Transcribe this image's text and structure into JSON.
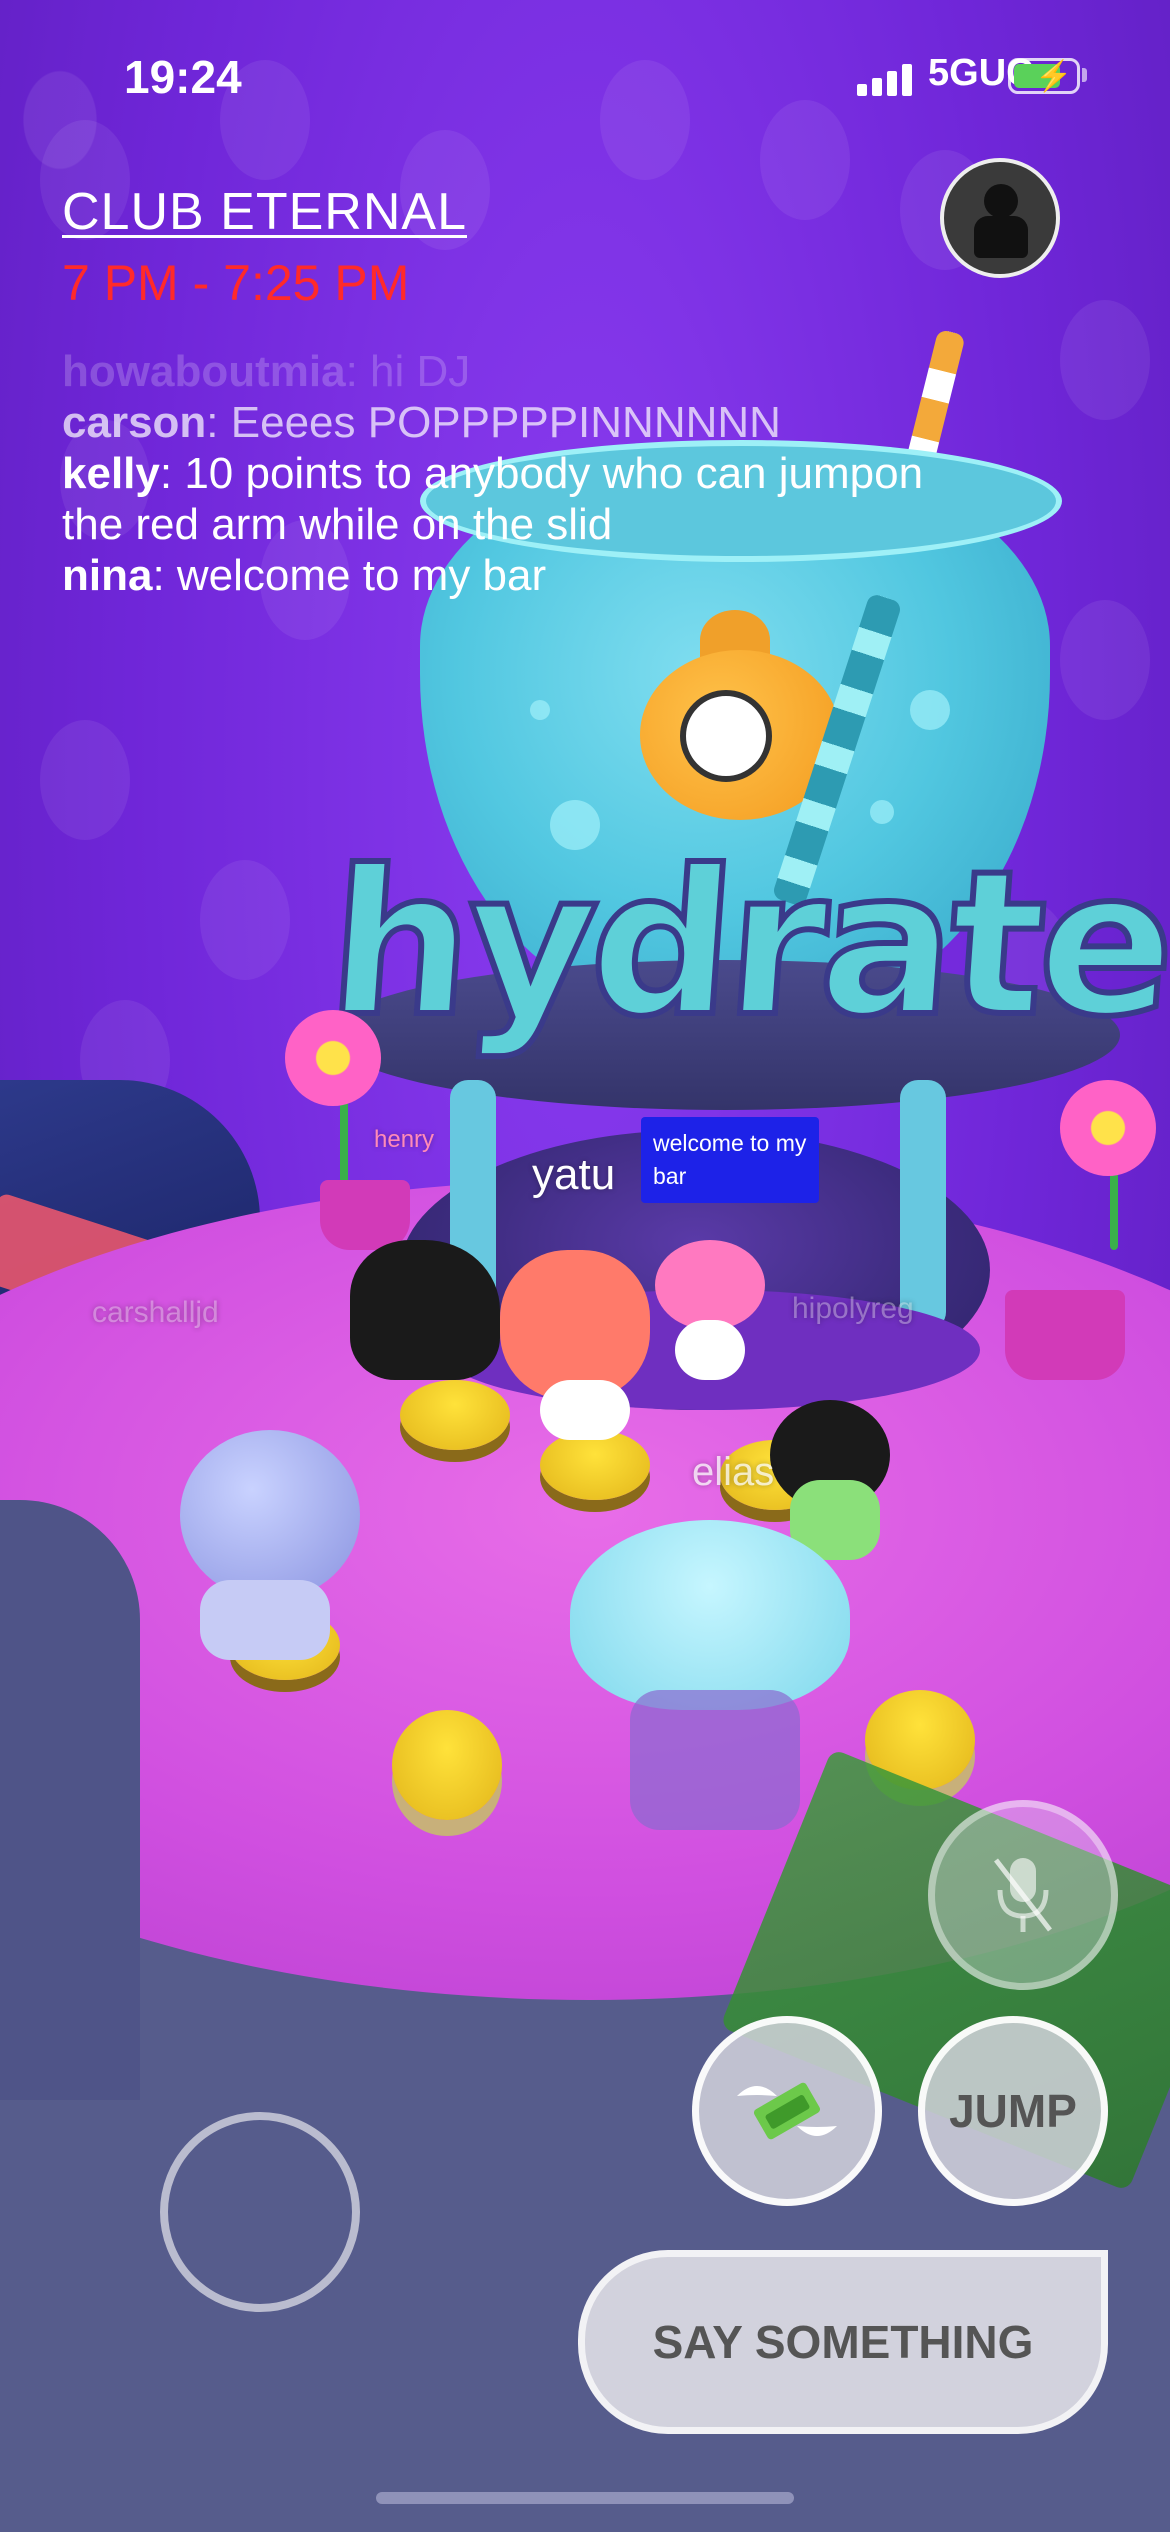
{
  "status_bar": {
    "time": "19:24",
    "network": "5GUC",
    "battery_icon": "battery-charging-icon",
    "signal_icon": "cellular-signal-icon"
  },
  "header": {
    "title": "CLUB ETERNAL",
    "schedule": "7 PM - 7:25 PM",
    "profile_icon": "avatar-silhouette-icon"
  },
  "chat": [
    {
      "user": "howaboutmia",
      "message": ": hi DJ"
    },
    {
      "user": "carson",
      "message": ": Eeees POPPPPPINNNNNN"
    },
    {
      "user": "kelly",
      "message": ": 10 points to anybody who can jumpon the red arm while on the slid"
    },
    {
      "user": "nina",
      "message": ": welcome to my bar"
    }
  ],
  "scene": {
    "sign": "hydrate",
    "speech_bubble": "welcome to my bar",
    "nametags": {
      "yatu": "yatu",
      "elias": "elias",
      "henry": "henry",
      "carshalljd": "carshalljd",
      "hipolyreg": "hipolyreg"
    }
  },
  "controls": {
    "jump_label": "JUMP",
    "say_label": "SAY SOMETHING",
    "mic_icon": "mic-muted-icon",
    "tip_icon": "winged-money-icon"
  },
  "colors": {
    "background": "#7a2fe0",
    "schedule_red": "#ff2a2a",
    "speech_bubble": "#1d22e8"
  }
}
